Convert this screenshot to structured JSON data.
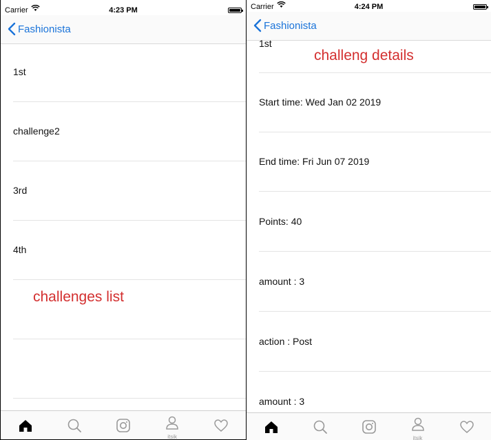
{
  "left_screen": {
    "status_bar": {
      "carrier": "Carrier",
      "time": "4:23 PM"
    },
    "nav": {
      "back_label": "Fashionista"
    },
    "list_items": [
      "1st",
      "challenge2",
      "3rd",
      "4th"
    ],
    "annotation": "challenges list",
    "tabs": [
      {
        "icon": "home-icon",
        "active": true
      },
      {
        "icon": "search-icon",
        "active": false
      },
      {
        "icon": "instagram-icon",
        "active": false
      },
      {
        "icon": "profile-icon",
        "label": "itsik",
        "active": false
      },
      {
        "icon": "heart-icon",
        "active": false
      }
    ]
  },
  "right_screen": {
    "status_bar": {
      "carrier": "Carrier",
      "time": "4:24 PM"
    },
    "nav": {
      "back_label": "Fashionista"
    },
    "detail_rows": [
      "1st",
      "Start time: Wed Jan 02 2019",
      "End time: Fri Jun 07 2019",
      "Points: 40",
      "amount : 3",
      "action : Post",
      "amount : 3"
    ],
    "annotation": "challeng details",
    "tabs": [
      {
        "icon": "home-icon",
        "active": true
      },
      {
        "icon": "search-icon",
        "active": false
      },
      {
        "icon": "instagram-icon",
        "active": false
      },
      {
        "icon": "profile-icon",
        "label": "itsik",
        "active": false
      },
      {
        "icon": "heart-icon",
        "active": false
      }
    ]
  },
  "colors": {
    "accent": "#1a73d9",
    "annotation": "#d32f2f",
    "separator": "#e4e4e4"
  }
}
